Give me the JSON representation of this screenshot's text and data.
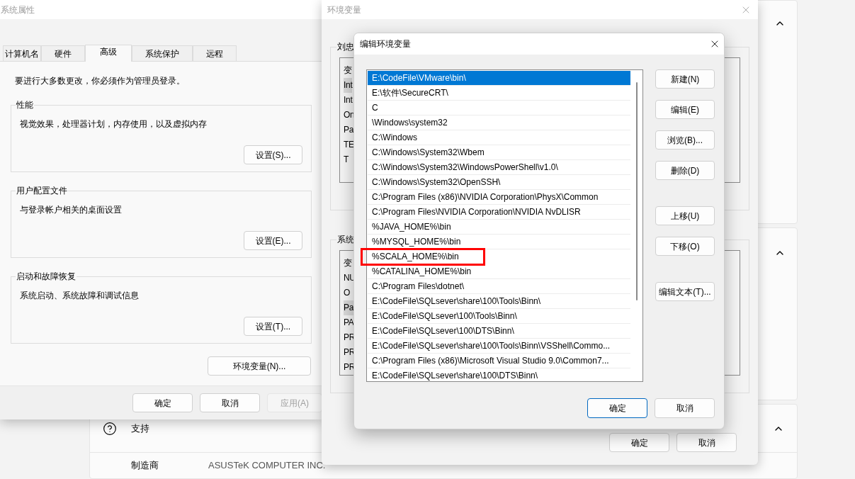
{
  "settings_background": {
    "support_title": "支持",
    "manufacturer_label": "制造商",
    "manufacturer_value": "ASUSTeK COMPUTER INC."
  },
  "system_properties": {
    "title": "系统属性",
    "tabs": [
      {
        "label": "计算机名",
        "selected": false
      },
      {
        "label": "硬件",
        "selected": false
      },
      {
        "label": "高级",
        "selected": true
      },
      {
        "label": "系统保护",
        "selected": false
      },
      {
        "label": "远程",
        "selected": false
      }
    ],
    "notice": "要进行大多数更改，你必须作为管理员登录。",
    "groups": [
      {
        "title": "性能",
        "description": "视觉效果，处理器计划，内存使用，以及虚拟内存",
        "button": "设置(S)..."
      },
      {
        "title": "用户配置文件",
        "description": "与登录帐户相关的桌面设置",
        "button": "设置(E)..."
      },
      {
        "title": "启动和故障恢复",
        "description": "系统启动、系统故障和调试信息",
        "button": "设置(T)..."
      }
    ],
    "env_button": "环境变量(N)...",
    "footer_buttons": [
      {
        "label": "确定",
        "disabled": false
      },
      {
        "label": "取消",
        "disabled": false
      },
      {
        "label": "应用(A)",
        "disabled": true
      }
    ]
  },
  "environment_variables": {
    "title": "环境变量",
    "sections": [
      {
        "label": "刘忠",
        "header": "变",
        "rows": [
          {
            "text": "Int",
            "selected": true
          },
          {
            "text": "Int",
            "selected": false
          },
          {
            "text": "On",
            "selected": false
          },
          {
            "text": "Pa",
            "selected": false
          },
          {
            "text": "TE",
            "selected": false
          },
          {
            "text": "T",
            "selected": false
          }
        ]
      },
      {
        "label": "系统",
        "header": "变",
        "rows": [
          {
            "text": "NU",
            "selected": false
          },
          {
            "text": "O",
            "selected": false
          },
          {
            "text": "Pa",
            "selected": true
          },
          {
            "text": "PA",
            "selected": false
          },
          {
            "text": "PR",
            "selected": false
          },
          {
            "text": "PR",
            "selected": false
          },
          {
            "text": "PR",
            "selected": false
          }
        ]
      }
    ],
    "footer_buttons": [
      {
        "label": "确定"
      },
      {
        "label": "取消"
      }
    ]
  },
  "edit_dialog": {
    "title": "编辑环境变量",
    "entries": [
      {
        "text": "E:\\CodeFile\\VMware\\bin\\",
        "selected": true,
        "marked": false
      },
      {
        "text": "E:\\软件\\SecureCRT\\",
        "selected": false,
        "marked": false
      },
      {
        "text": "C",
        "selected": false,
        "marked": false
      },
      {
        "text": "\\Windows\\system32",
        "selected": false,
        "marked": false
      },
      {
        "text": "C:\\Windows",
        "selected": false,
        "marked": false
      },
      {
        "text": "C:\\Windows\\System32\\Wbem",
        "selected": false,
        "marked": false
      },
      {
        "text": "C:\\Windows\\System32\\WindowsPowerShell\\v1.0\\",
        "selected": false,
        "marked": false
      },
      {
        "text": "C:\\Windows\\System32\\OpenSSH\\",
        "selected": false,
        "marked": false
      },
      {
        "text": "C:\\Program Files (x86)\\NVIDIA Corporation\\PhysX\\Common",
        "selected": false,
        "marked": false
      },
      {
        "text": "C:\\Program Files\\NVIDIA Corporation\\NVIDIA NvDLISR",
        "selected": false,
        "marked": false
      },
      {
        "text": "%JAVA_HOME%\\bin",
        "selected": false,
        "marked": false
      },
      {
        "text": "%MYSQL_HOME%\\bin",
        "selected": false,
        "marked": false
      },
      {
        "text": "%SCALA_HOME%\\bin",
        "selected": false,
        "marked": true
      },
      {
        "text": "%CATALINA_HOME%\\bin",
        "selected": false,
        "marked": false
      },
      {
        "text": "C:\\Program Files\\dotnet\\",
        "selected": false,
        "marked": false
      },
      {
        "text": "E:\\CodeFile\\SQLsever\\share\\100\\Tools\\Binn\\",
        "selected": false,
        "marked": false
      },
      {
        "text": "E:\\CodeFile\\SQLsever\\100\\Tools\\Binn\\",
        "selected": false,
        "marked": false
      },
      {
        "text": "E:\\CodeFile\\SQLsever\\100\\DTS\\Binn\\",
        "selected": false,
        "marked": false
      },
      {
        "text": "E:\\CodeFile\\SQLsever\\share\\100\\Tools\\Binn\\VSShell\\Commo...",
        "selected": false,
        "marked": false
      },
      {
        "text": "C:\\Program Files (x86)\\Microsoft Visual Studio 9.0\\Common7...",
        "selected": false,
        "marked": false
      },
      {
        "text": "E:\\CodeFile\\SQLsever\\share\\100\\DTS\\Binn\\",
        "selected": false,
        "marked": false
      }
    ],
    "side_button_groups": [
      [
        "新建(N)",
        "编辑(E)",
        "浏览(B)...",
        "删除(D)"
      ],
      [
        "上移(U)",
        "下移(O)"
      ],
      [
        "编辑文本(T)..."
      ]
    ],
    "footer_buttons": [
      {
        "label": "确定",
        "default": true
      },
      {
        "label": "取消",
        "default": false
      }
    ]
  }
}
